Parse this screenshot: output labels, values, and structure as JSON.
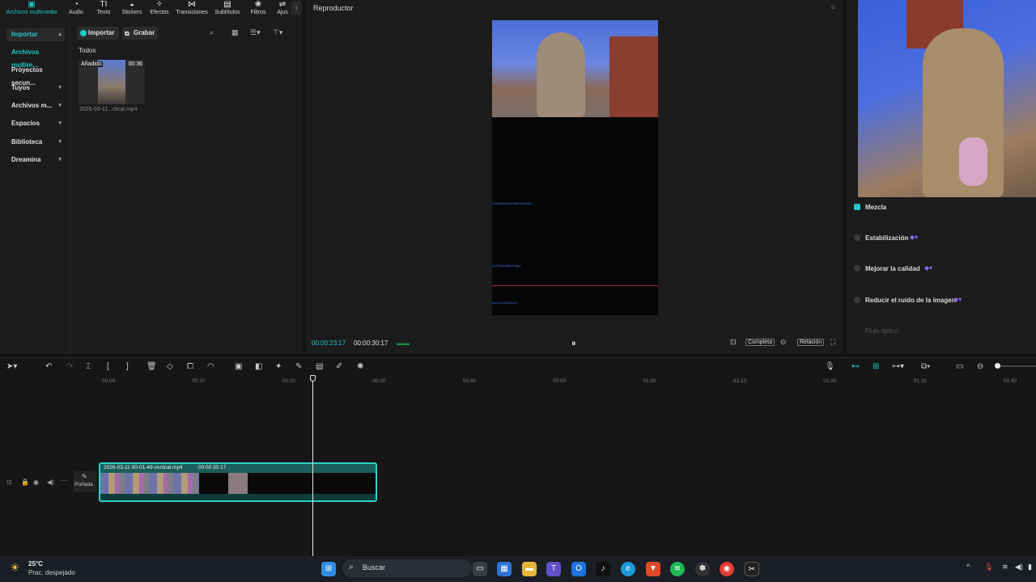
{
  "toolbar": {
    "tabs": [
      {
        "label": "Archivos multimedia",
        "icon": "media-icon"
      },
      {
        "label": "Audio",
        "icon": "audio-icon"
      },
      {
        "label": "Texto",
        "icon": "text-icon"
      },
      {
        "label": "Stickers",
        "icon": "sticker-icon"
      },
      {
        "label": "Efectos",
        "icon": "effects-icon"
      },
      {
        "label": "Transiciones",
        "icon": "transitions-icon"
      },
      {
        "label": "Subtítulos",
        "icon": "subtitles-icon"
      },
      {
        "label": "Filtros",
        "icon": "filters-icon"
      },
      {
        "label": "Ajus",
        "icon": "adjust-icon"
      }
    ]
  },
  "sidebar": {
    "items": [
      {
        "label": "Importar"
      },
      {
        "label": "Archivos multim..."
      },
      {
        "label": "Proyectos secun..."
      },
      {
        "label": "Tuyos"
      },
      {
        "label": "Archivos m..."
      },
      {
        "label": "Espacios"
      },
      {
        "label": "Biblioteca"
      },
      {
        "label": "Dreamina"
      }
    ]
  },
  "media": {
    "import_label": "Importar",
    "record_label": "Grabar",
    "filter_label": "Todos",
    "clip": {
      "badge": "Añadido",
      "duration": "00:36",
      "filename": "2026-03-11...rtical.mp4"
    }
  },
  "player": {
    "title": "Reproductor",
    "current_time": "00:00:23:17",
    "total_time": "00:00:30:17",
    "full_label": "Completa",
    "ratio_label": "Relación",
    "overlay_texts": [
      "e3a19d6f0ab09b8f7fb2d6b1",
      "2d7f3e8baf6f42ngm",
      "ntry7mo8j33z2v4"
    ]
  },
  "right_panel": {
    "items": [
      {
        "label": "Mezcla",
        "checked": true
      },
      {
        "label": "Estabilización",
        "checked": false
      },
      {
        "label": "Mejorar la calidad",
        "checked": false
      },
      {
        "label": "Reducir el ruido de la imagen",
        "checked": false
      },
      {
        "label": "Flujo óptico",
        "checked": false
      }
    ]
  },
  "timeline": {
    "ticks": [
      "00:00",
      "00:10",
      "00:20",
      "00:30",
      "00:40",
      "00:50",
      "01:00",
      "01:10",
      "01:20",
      "01:30",
      "01:40"
    ],
    "cover_label": "Portada",
    "clip_name": "2026-03-11 00-01-49-vertical.mp4",
    "clip_duration": "00:00:30:17"
  },
  "taskbar": {
    "temperature": "25°C",
    "weather": "Prac. despejado",
    "search_placeholder": "Buscar"
  },
  "colors": {
    "accent": "#1ec8c8",
    "bg": "#1c1c1c",
    "clip_border": "#2ad1c9"
  }
}
